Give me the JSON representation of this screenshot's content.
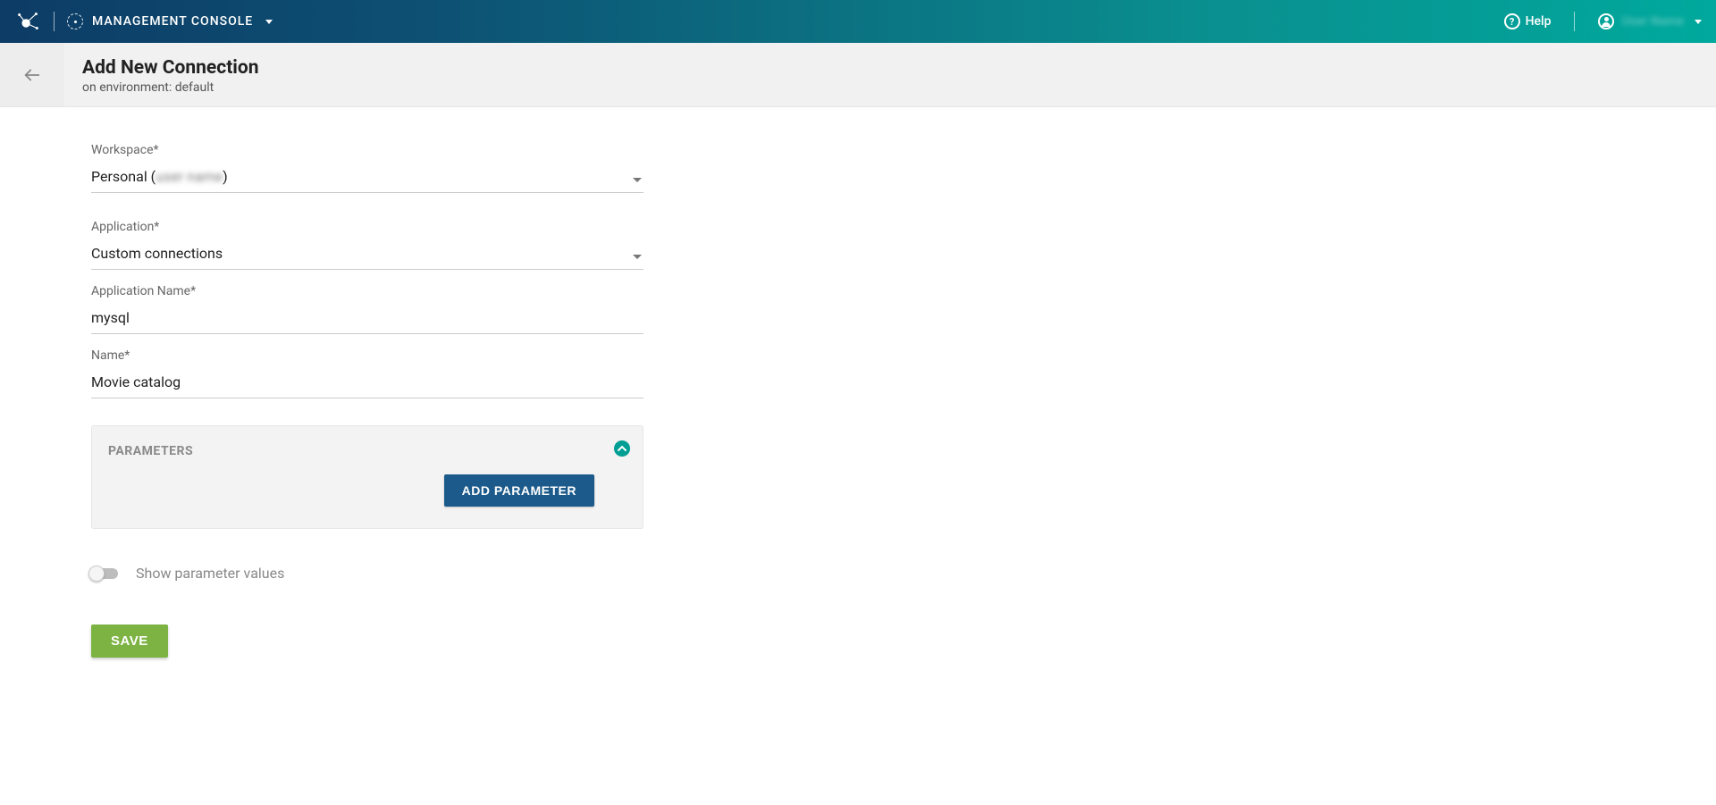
{
  "topbar": {
    "app_title": "MANAGEMENT CONSOLE",
    "help_label": "Help",
    "user_name": "User Name"
  },
  "header": {
    "title": "Add New Connection",
    "subtitle_prefix": "on environment: ",
    "environment": "default"
  },
  "form": {
    "workspace": {
      "label": "Workspace*",
      "value_prefix": "Personal (",
      "value_user": "user name",
      "value_suffix": ")"
    },
    "application": {
      "label": "Application*",
      "value": "Custom connections"
    },
    "application_name": {
      "label": "Application Name*",
      "value": "mysql"
    },
    "name": {
      "label": "Name*",
      "value": "Movie catalog"
    }
  },
  "panel": {
    "title": "PARAMETERS",
    "add_button": "ADD PARAMETER"
  },
  "toggle": {
    "label": "Show parameter values"
  },
  "actions": {
    "save": "SAVE"
  }
}
